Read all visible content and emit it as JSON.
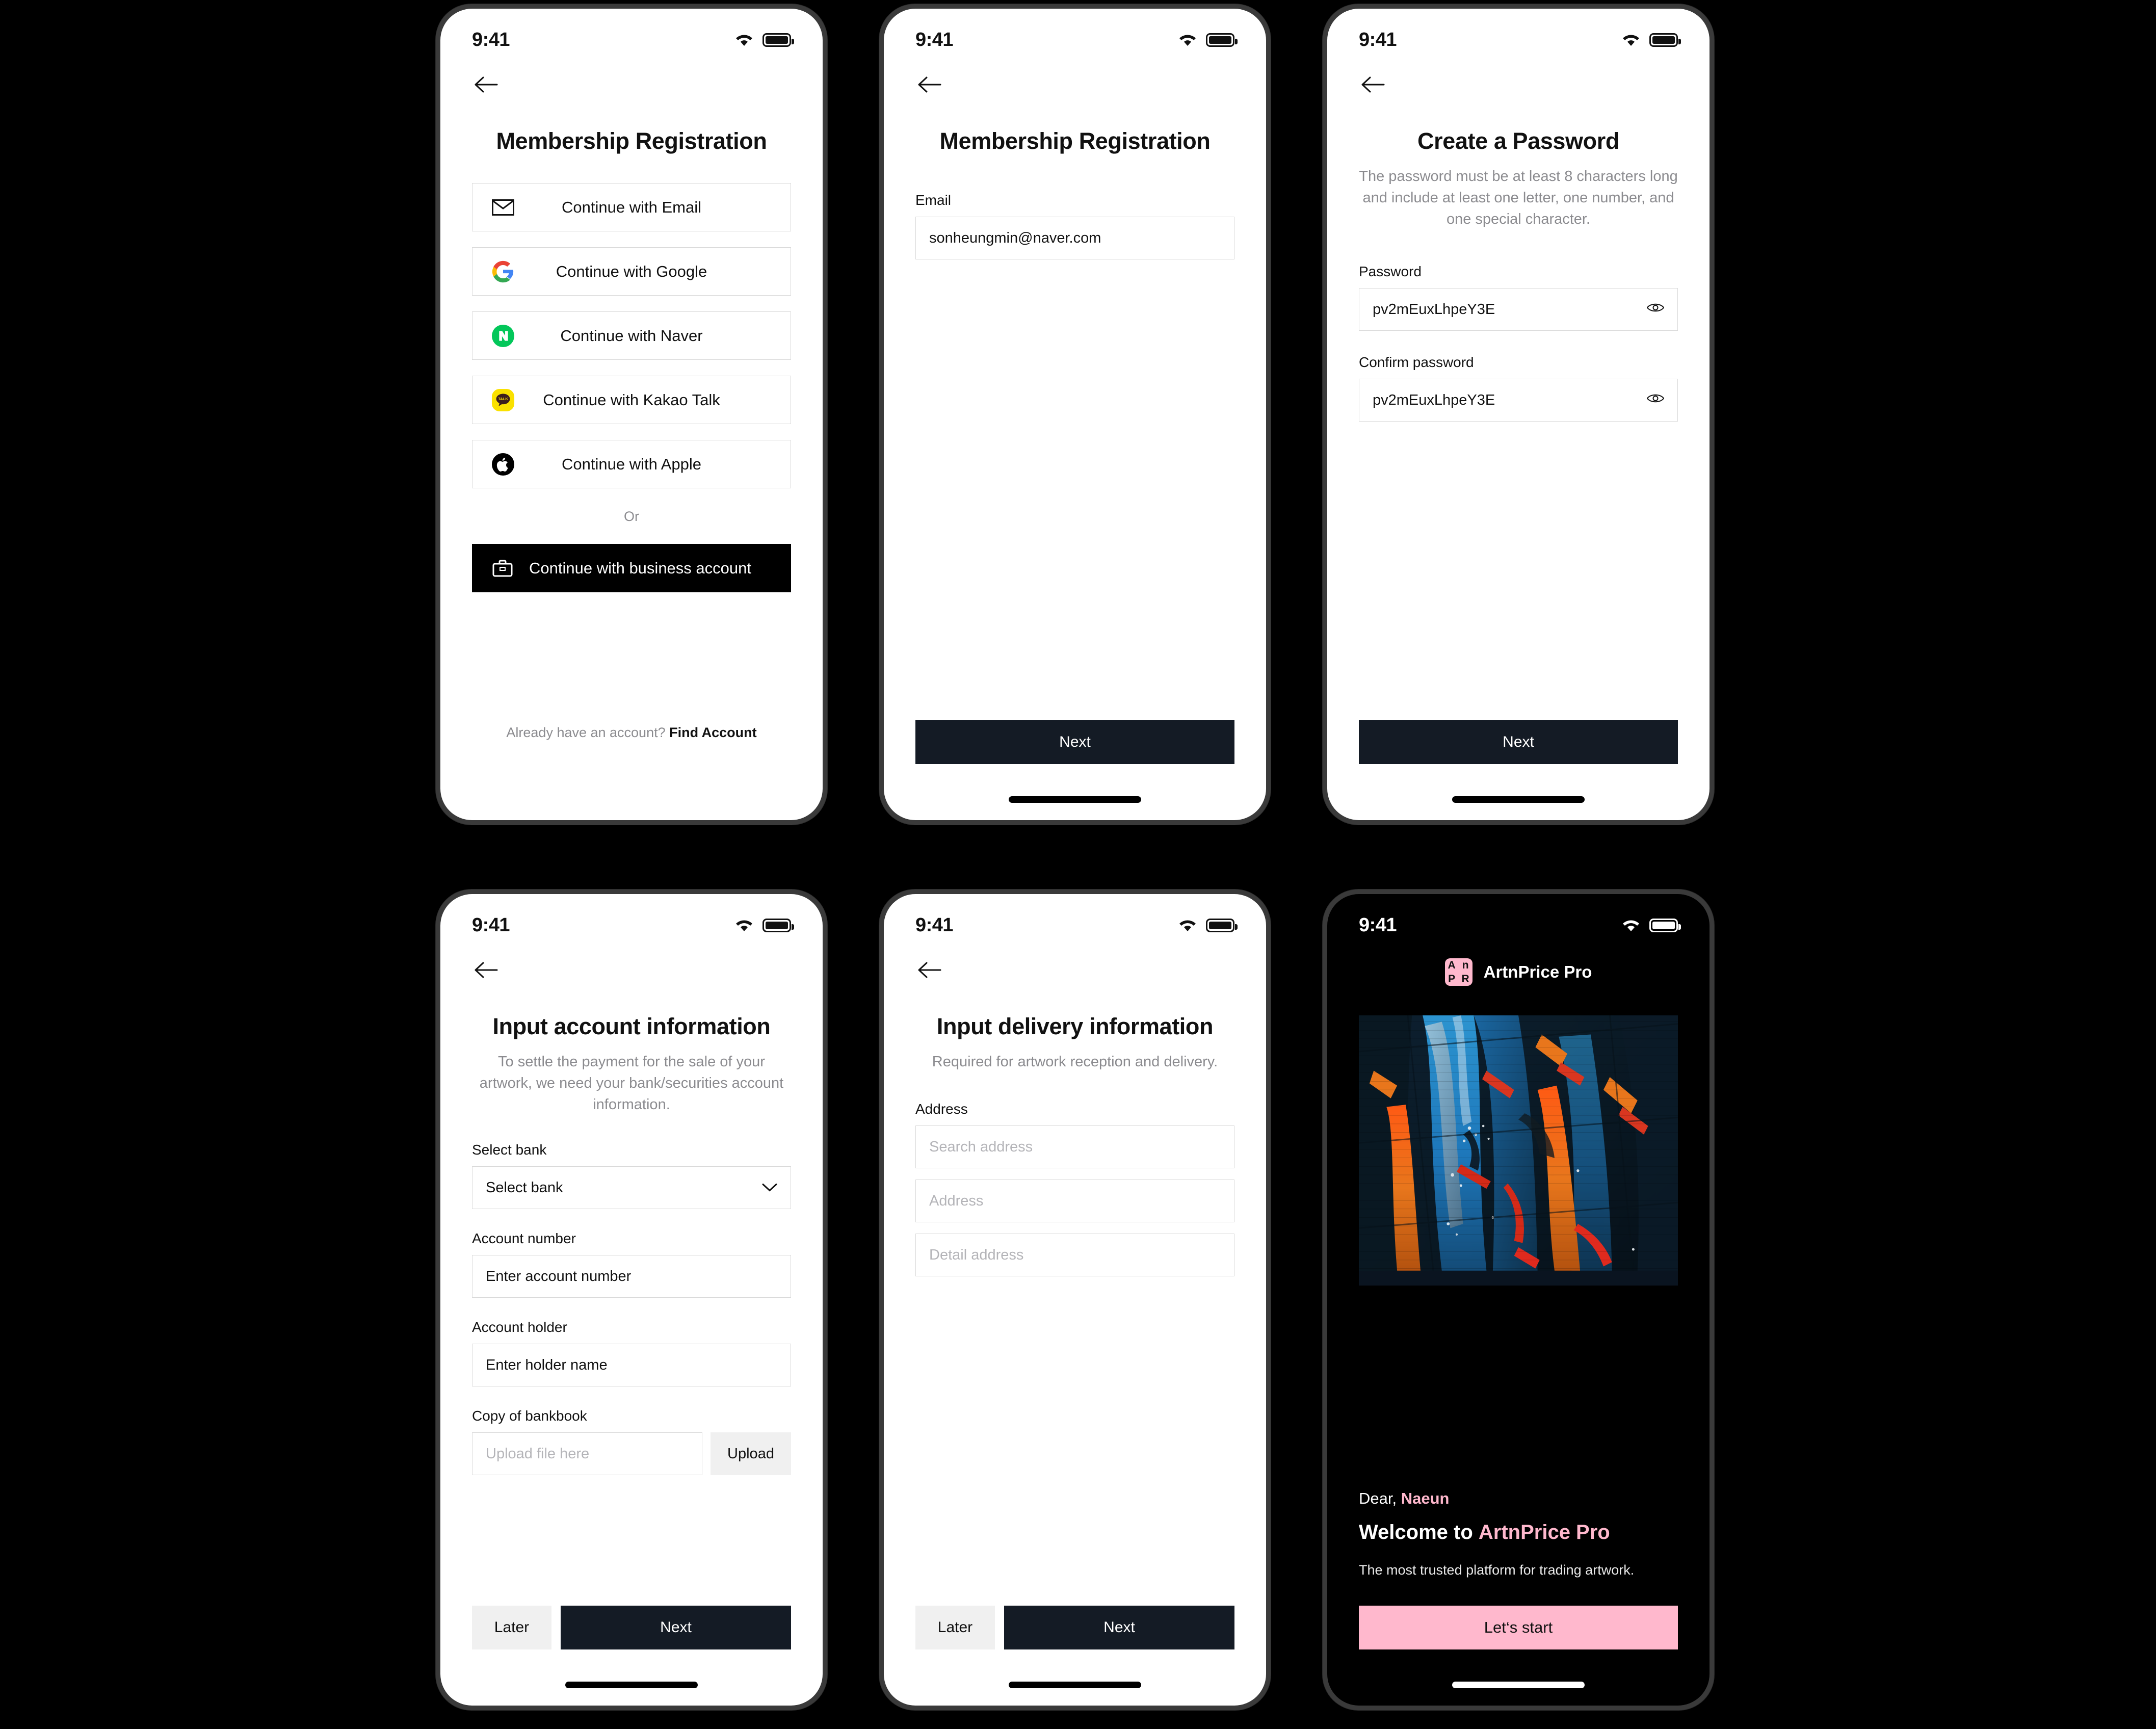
{
  "statusbar": {
    "time": "9:41"
  },
  "screen1": {
    "title": "Membership Registration",
    "social_buttons": [
      {
        "icon": "envelope-icon",
        "label": "Continue with Email"
      },
      {
        "icon": "google-icon",
        "label": "Continue with Google"
      },
      {
        "icon": "naver-icon",
        "label": "Continue with Naver"
      },
      {
        "icon": "kakao-talk-icon",
        "label": "Continue with Kakao Talk"
      },
      {
        "icon": "apple-icon",
        "label": "Continue with Apple"
      }
    ],
    "or_label": "Or",
    "business_button": {
      "icon": "briefcase-icon",
      "label": "Continue with business account"
    },
    "find_account_prefix": "Already have an account? ",
    "find_account_link": "Find Account"
  },
  "screen2": {
    "title": "Membership Registration",
    "email_label": "Email",
    "email_value": "sonheungmin@naver.com",
    "next_label": "Next"
  },
  "screen3": {
    "title": "Create a Password",
    "subtitle": "The password must be at least 8 characters long and include at least one letter, one number, and one special character.",
    "password_label": "Password",
    "password_value": "pv2mEuxLhpeY3E",
    "confirm_label": "Confirm password",
    "confirm_value": "pv2mEuxLhpeY3E",
    "next_label": "Next"
  },
  "screen4": {
    "title": "Input account information",
    "subtitle": "To settle the payment for the sale of your artwork, we need your bank/securities account information.",
    "bank_label": "Select bank",
    "bank_value": "Select bank",
    "account_number_label": "Account number",
    "account_number_placeholder": "Enter account number",
    "account_holder_label": "Account holder",
    "account_holder_placeholder": "Enter holder name",
    "bankbook_label": "Copy of bankbook",
    "bankbook_placeholder": "Upload file here",
    "upload_label": "Upload",
    "later_label": "Later",
    "next_label": "Next"
  },
  "screen5": {
    "title": "Input delivery information",
    "subtitle": "Required for artwork reception and delivery.",
    "address_label": "Address",
    "search_placeholder": "Search address",
    "address_placeholder": "Address",
    "detail_placeholder": "Detail address",
    "later_label": "Later",
    "next_label": "Next"
  },
  "screen6": {
    "brand_name": "ArtnPrice Pro",
    "logo_letters": [
      "A",
      "n",
      "P",
      "R"
    ],
    "dear_prefix": "Dear, ",
    "dear_name": "Naeun",
    "welcome_prefix": "Welcome to ",
    "welcome_brand": "ArtnPrice Pro",
    "tagline": "The most trusted platform for trading artwork.",
    "start_label": "Let‘s start"
  },
  "colors": {
    "accent_pink": "#ffb8cd",
    "dark_navy": "#141b25",
    "black": "#000000",
    "muted_gray": "#8b8b8f",
    "border_gray": "#d9d9d9",
    "light_gray": "#f0f0f0"
  }
}
